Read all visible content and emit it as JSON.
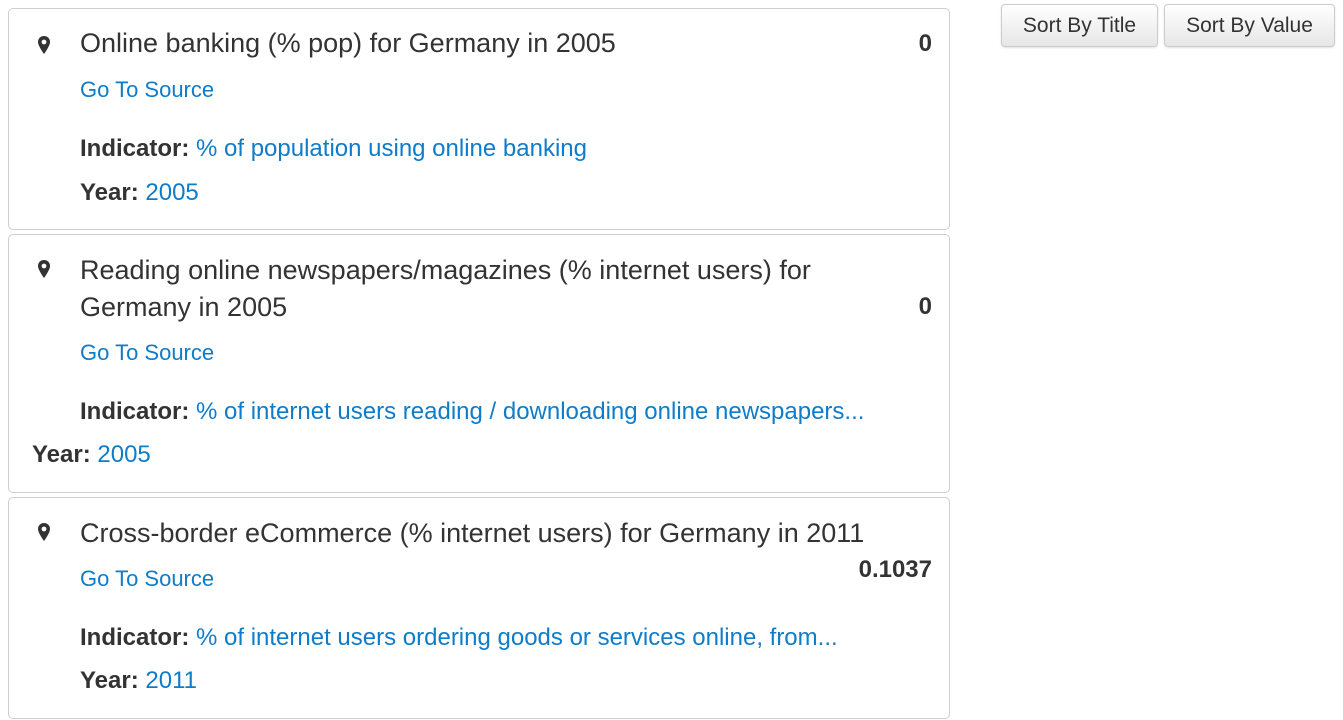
{
  "toolbar": {
    "sort_title_label": "Sort By Title",
    "sort_value_label": "Sort By Value"
  },
  "labels": {
    "indicator": "Indicator:",
    "year": "Year:",
    "source_link": "Go To Source"
  },
  "colors": {
    "link": "#0f7cc9",
    "text": "#333333",
    "border": "#cfcfcf"
  },
  "icons": {
    "location": "map-marker-icon"
  },
  "results": [
    {
      "title": "Online banking (% pop) for Germany in 2005",
      "value": "0",
      "indicator": "% of population using online banking",
      "year": "2005"
    },
    {
      "title": "Reading online newspapers/magazines (% internet users) for Germany in 2005",
      "value": "0",
      "indicator": "% of internet users reading / downloading online newspapers...",
      "year": "2005"
    },
    {
      "title": "Cross-border eCommerce (% internet users) for Germany in 2011",
      "value": "0.1037",
      "indicator": "% of internet users ordering goods or services online, from...",
      "year": "2011"
    }
  ]
}
